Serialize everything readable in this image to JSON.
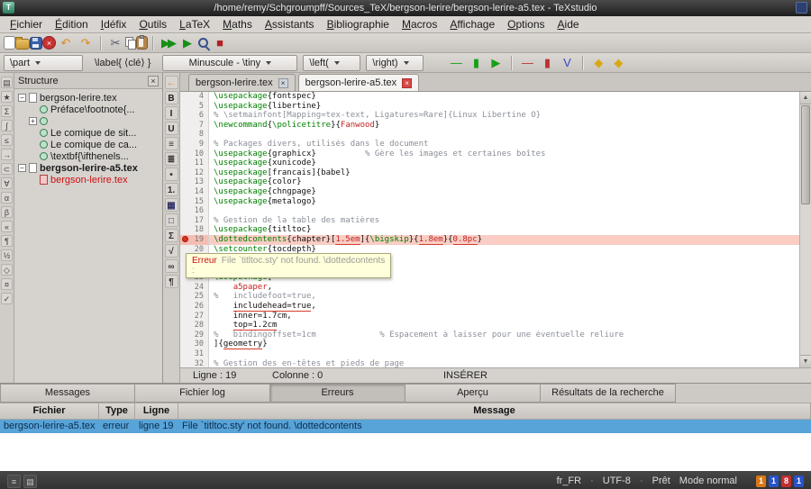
{
  "window": {
    "title": "/home/remy/Schgroumpff/Sources_TeX/bergson-lerire/bergson-lerire-a5.tex - TeXstudio"
  },
  "glyphs": {
    "close": "×",
    "up": "▲",
    "down": "▼",
    "app": "T"
  },
  "menubar": {
    "items": [
      "Fichier",
      "Édition",
      "Idéfix",
      "Outils",
      "LaTeX",
      "Maths",
      "Assistants",
      "Bibliographie",
      "Macros",
      "Affichage",
      "Options",
      "Aide"
    ]
  },
  "toolbar1": {
    "icons": [
      {
        "name": "new-document-icon",
        "css": "i-new"
      },
      {
        "name": "open-file-icon",
        "css": "i-open"
      },
      {
        "name": "save-icon",
        "css": "i-save"
      },
      {
        "name": "close-file-icon",
        "css": "i-closec",
        "glyph": "×"
      },
      {
        "name": "undo-icon",
        "glyph": "↶",
        "color": "#e08818"
      },
      {
        "name": "redo-icon",
        "glyph": "↷",
        "color": "#e08818"
      },
      {
        "sep": true
      },
      {
        "name": "cut-icon",
        "glyph": "✂",
        "color": "#556"
      },
      {
        "name": "copy-icon",
        "css": "i-copy"
      },
      {
        "name": "paste-icon",
        "css": "i-paste"
      },
      {
        "sep": true
      },
      {
        "name": "build-and-view-icon",
        "glyph": "▶▶",
        "color": "#159015",
        "cls": "gg2"
      },
      {
        "name": "compile-icon",
        "glyph": "▶",
        "color": "#159015"
      },
      {
        "name": "view-icon",
        "css": "i-view"
      },
      {
        "name": "stop-icon",
        "glyph": "■",
        "color": "#b02020"
      }
    ]
  },
  "toolbar2": {
    "combos": [
      {
        "name": "sectioning-combo",
        "label": "\\part",
        "w": 88,
        "arrow": true
      },
      {
        "name": "label-button",
        "label": "\\label{ ⟨clé⟩ }",
        "flat": true
      },
      {
        "name": "fontsize-combo",
        "label": "Minuscule - \\tiny",
        "w": 150,
        "arrow": true,
        "center": true
      },
      {
        "name": "left-delimiter-combo",
        "label": "\\left(",
        "w": 64,
        "arrow": true
      },
      {
        "name": "right-delimiter-combo",
        "label": "\\right)",
        "w": 64,
        "arrow": true
      }
    ],
    "icons": [
      {
        "name": "green-line-icon",
        "glyph": "—",
        "color": "#18a018"
      },
      {
        "name": "green-bar-icon",
        "glyph": "▮",
        "color": "#18a018"
      },
      {
        "name": "green-play-icon",
        "glyph": "▶",
        "color": "#18a018"
      },
      {
        "sep": true
      },
      {
        "name": "red-line-icon",
        "glyph": "—",
        "color": "#c03030"
      },
      {
        "name": "red-bar-icon",
        "glyph": "▮",
        "color": "#c03030"
      },
      {
        "name": "blue-v-icon",
        "glyph": "V",
        "color": "#3048c0"
      },
      {
        "sep": true
      },
      {
        "name": "lamp-icon-1",
        "glyph": "◆",
        "color": "#d8a818"
      },
      {
        "name": "lamp-icon-2",
        "glyph": "◆",
        "color": "#d8a818"
      }
    ]
  },
  "left_strip": {
    "icons": [
      "▤",
      "★",
      "Σ",
      "∫",
      "≤",
      "→",
      "⊂",
      "∀",
      "α",
      "β",
      "«",
      "¶",
      "½",
      "◇",
      "¤",
      "✓"
    ]
  },
  "edit_strip": {
    "icons": [
      {
        "glyph": "←",
        "color": "#e08818"
      },
      {
        "glyph": "B",
        "color": "#222"
      },
      {
        "glyph": "I",
        "color": "#222"
      },
      {
        "glyph": "U",
        "color": "#222"
      },
      {
        "glyph": "≡",
        "color": "#333"
      },
      {
        "glyph": "≣",
        "color": "#333"
      },
      {
        "glyph": "•",
        "color": "#333"
      },
      {
        "glyph": "1.",
        "color": "#333"
      },
      {
        "glyph": "▦",
        "color": "#336"
      },
      {
        "glyph": "□",
        "color": "#336"
      },
      {
        "glyph": "Σ",
        "color": "#333"
      },
      {
        "glyph": "√",
        "color": "#333"
      },
      {
        "glyph": "∞",
        "color": "#333"
      },
      {
        "glyph": "¶",
        "color": "#333"
      }
    ]
  },
  "structure_panel": {
    "title": "Structure",
    "tree": [
      {
        "indent": 0,
        "expander": "−",
        "icon": "file",
        "label": "bergson-lerire.tex"
      },
      {
        "indent": 1,
        "expander": "",
        "icon": "section",
        "label": "Préface\\footnote{..."
      },
      {
        "indent": 1,
        "expander": "+",
        "icon": "section",
        "label": ""
      },
      {
        "indent": 1,
        "expander": "",
        "icon": "section",
        "label": "Le comique de sit..."
      },
      {
        "indent": 1,
        "expander": "",
        "icon": "section",
        "label": "Le comique de ca..."
      },
      {
        "indent": 1,
        "expander": "",
        "icon": "section",
        "label": "\\textbf{\\ifthenels..."
      },
      {
        "indent": 0,
        "expander": "−",
        "icon": "file",
        "label": "bergson-lerire-a5.tex",
        "bold": true
      },
      {
        "indent": 1,
        "expander": "",
        "icon": "filered",
        "label": "bergson-lerire.tex",
        "color": "#cc1111"
      }
    ]
  },
  "editor": {
    "tabs": [
      {
        "label": "bergson-lerire.tex",
        "active": false
      },
      {
        "label": "bergson-lerire-a5.tex",
        "active": true
      }
    ],
    "lines": [
      {
        "num": 4,
        "t": [
          [
            "c",
            "\\usepackage"
          ],
          [
            "x",
            "{fontspec}"
          ]
        ]
      },
      {
        "num": 5,
        "t": [
          [
            "c",
            "\\usepackage"
          ],
          [
            "x",
            "{libertine}"
          ]
        ]
      },
      {
        "num": 6,
        "t": [
          [
            "m",
            "% \\setmainfont[Mapping=tex-text, Ligatures=Rare]{Linux Libertine O}"
          ]
        ]
      },
      {
        "num": 7,
        "t": [
          [
            "c",
            "\\newcommand"
          ],
          [
            "x",
            "{"
          ],
          [
            "c",
            "\\policetitre"
          ],
          [
            "x",
            "}{"
          ],
          [
            "e",
            "Fanwood"
          ],
          [
            "x",
            "}"
          ]
        ]
      },
      {
        "num": 8,
        "t": []
      },
      {
        "num": 9,
        "t": [
          [
            "m",
            "% Packages divers, utilisés dans le document"
          ]
        ]
      },
      {
        "num": 10,
        "t": [
          [
            "c",
            "\\usepackage"
          ],
          [
            "x",
            "{graphicx}          "
          ],
          [
            "m",
            "% Gère les images et certaines boîtes"
          ]
        ]
      },
      {
        "num": 11,
        "t": [
          [
            "c",
            "\\usepackage"
          ],
          [
            "x",
            "{xunicode}"
          ]
        ]
      },
      {
        "num": 12,
        "t": [
          [
            "c",
            "\\usepackage"
          ],
          [
            "x",
            "[francais]{babel}"
          ]
        ]
      },
      {
        "num": 13,
        "t": [
          [
            "c",
            "\\usepackage"
          ],
          [
            "x",
            "{color}"
          ]
        ]
      },
      {
        "num": 14,
        "t": [
          [
            "c",
            "\\usepackage"
          ],
          [
            "x",
            "{chngpage}"
          ]
        ]
      },
      {
        "num": 15,
        "t": [
          [
            "c",
            "\\usepackage"
          ],
          [
            "x",
            "{metalogo}"
          ]
        ]
      },
      {
        "num": 16,
        "t": []
      },
      {
        "num": 17,
        "t": [
          [
            "m",
            "% Gestion de la table des matières"
          ]
        ]
      },
      {
        "num": 18,
        "t": [
          [
            "c",
            "\\usepackage"
          ],
          [
            "x",
            "{titltoc}"
          ]
        ]
      },
      {
        "num": 19,
        "err": true,
        "t": [
          [
            "c",
            "\\dottedcontents"
          ],
          [
            "x",
            "{chapter}["
          ],
          [
            "e",
            "1.5em"
          ],
          [
            "x",
            "]{"
          ],
          [
            "c",
            "\\bigskip"
          ],
          [
            "x",
            "}{"
          ],
          [
            "e",
            "1.8em"
          ],
          [
            "x",
            "}{"
          ],
          [
            "e",
            "0.8pc"
          ],
          [
            "x",
            "}"
          ]
        ]
      },
      {
        "num": 20,
        "t": [
          [
            "c",
            "\\setcounter"
          ],
          [
            "x",
            "{tocdepth}"
          ]
        ]
      },
      {
        "num": 21,
        "t": []
      },
      {
        "num": 22,
        "t": []
      },
      {
        "num": 23,
        "t": [
          [
            "c",
            "\\usepackage"
          ],
          [
            "x",
            "["
          ]
        ]
      },
      {
        "num": 24,
        "t": [
          [
            "x",
            "    "
          ],
          [
            "e",
            "a5paper"
          ],
          [
            "x",
            ","
          ]
        ]
      },
      {
        "num": 25,
        "t": [
          [
            "m",
            "%   includefoot=true,"
          ]
        ]
      },
      {
        "num": 26,
        "t": [
          [
            "x",
            "    "
          ],
          [
            "s",
            "includehead=true"
          ],
          [
            "x",
            ","
          ]
        ]
      },
      {
        "num": 27,
        "t": [
          [
            "x",
            "    "
          ],
          [
            "s",
            "inner=1.7cm"
          ],
          [
            "x",
            ","
          ]
        ]
      },
      {
        "num": 28,
        "t": [
          [
            "x",
            "    "
          ],
          [
            "s",
            "top=1.2cm"
          ]
        ]
      },
      {
        "num": 29,
        "t": [
          [
            "m",
            "%   bindingoffset=1cm             % Espacement à laisser pour une éventuelle reliure"
          ]
        ]
      },
      {
        "num": 30,
        "t": [
          [
            "x",
            "]{"
          ],
          [
            "s",
            "geometry"
          ],
          [
            "x",
            "}"
          ]
        ]
      },
      {
        "num": 31,
        "t": []
      },
      {
        "num": 32,
        "t": [
          [
            "m",
            "% Gestion des en-têtes et pieds de page"
          ]
        ]
      }
    ],
    "tooltip": {
      "label": "Erreur",
      "message": "File `titltoc.sty' not found. \\dottedcontents",
      "suffix": ":"
    },
    "status": {
      "line_label": "Ligne : 19",
      "col_label": "Colonne : 0",
      "mode": "INSÉRER"
    }
  },
  "bottom_panel": {
    "tabs": [
      {
        "label": "Messages"
      },
      {
        "label": "Fichier log"
      },
      {
        "label": "Erreurs",
        "active": true
      },
      {
        "label": "Aperçu"
      },
      {
        "label": "Résultats de la recherche"
      }
    ],
    "table": {
      "headers": [
        "Fichier",
        "Type",
        "Ligne",
        "Message"
      ],
      "rows": [
        [
          "bergson-lerire-a5.tex",
          "erreur",
          "ligne 19",
          "File `titltoc.sty' not found. \\dottedcontents"
        ]
      ]
    }
  },
  "statusbar": {
    "left_icons": [
      {
        "name": "log-toggle-icon",
        "glyph": "≡"
      },
      {
        "name": "panel-toggle-icon",
        "glyph": "▤"
      }
    ],
    "items": [
      "fr_FR",
      "·",
      "UTF-8",
      "·",
      "Prêt",
      "Mode normal"
    ],
    "indicators": [
      {
        "label": "1",
        "color": "#d87818"
      },
      {
        "label": "1",
        "color": "#2a52c8"
      },
      {
        "label": "8",
        "color": "#c03030"
      },
      {
        "label": "1",
        "color": "#2a52c8"
      }
    ]
  }
}
